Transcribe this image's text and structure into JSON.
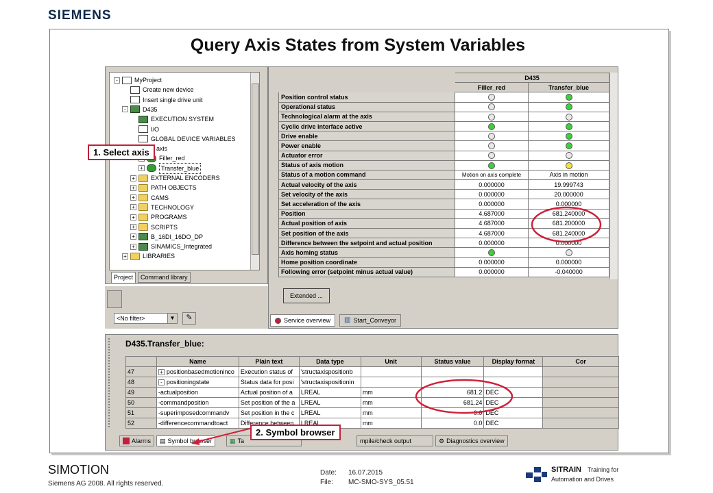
{
  "brand": "SIEMENS",
  "title": "Query Axis States from System Variables",
  "project_tree": {
    "items": [
      {
        "label": "MyProject",
        "level": 0,
        "icon": "project-icon",
        "expander": "-"
      },
      {
        "label": "Create new device",
        "level": 1,
        "icon": "new-device-icon",
        "expander": ""
      },
      {
        "label": "Insert single drive unit",
        "level": 1,
        "icon": "new-device-icon",
        "expander": ""
      },
      {
        "label": "D435",
        "level": 1,
        "icon": "device-icon",
        "expander": "-"
      },
      {
        "label": "EXECUTION SYSTEM",
        "level": 2,
        "icon": "execution-icon",
        "expander": ""
      },
      {
        "label": "I/O",
        "level": 2,
        "icon": "io-icon",
        "expander": ""
      },
      {
        "label": "GLOBAL DEVICE VARIABLES",
        "level": 2,
        "icon": "variables-icon",
        "expander": ""
      },
      {
        "label": "rt axis",
        "level": 2,
        "icon": "folder-icon",
        "expander": "-"
      },
      {
        "label": "Filler_red",
        "level": 3,
        "icon": "axis-icon",
        "expander": "+"
      },
      {
        "label": "Transfer_blue",
        "level": 3,
        "icon": "axis-icon",
        "expander": "+"
      },
      {
        "label": "EXTERNAL ENCODERS",
        "level": 2,
        "icon": "folder-icon",
        "expander": "+"
      },
      {
        "label": "PATH OBJECTS",
        "level": 2,
        "icon": "folder-icon",
        "expander": "+"
      },
      {
        "label": "CAMS",
        "level": 2,
        "icon": "folder-icon",
        "expander": "+"
      },
      {
        "label": "TECHNOLOGY",
        "level": 2,
        "icon": "folder-icon",
        "expander": "+"
      },
      {
        "label": "PROGRAMS",
        "level": 2,
        "icon": "folder-icon",
        "expander": "+"
      },
      {
        "label": "SCRIPTS",
        "level": 2,
        "icon": "folder-icon",
        "expander": "+"
      },
      {
        "label": "B_16DI_16DO_DP",
        "level": 2,
        "icon": "device-icon",
        "expander": "+"
      },
      {
        "label": "SINAMICS_Integrated",
        "level": 2,
        "icon": "device-icon",
        "expander": "+"
      },
      {
        "label": "LIBRARIES",
        "level": 1,
        "icon": "folder-icon",
        "expander": "+"
      }
    ],
    "tabs": [
      "Project",
      "Command library"
    ]
  },
  "filter": {
    "value": "<No filter>"
  },
  "service": {
    "device": "D435",
    "columns": [
      "Filler_red",
      "Transfer_blue"
    ],
    "rows": [
      {
        "label": "Position control status",
        "a": "off",
        "b": "on"
      },
      {
        "label": "Operational status",
        "a": "off",
        "b": "on"
      },
      {
        "label": "Technological alarm at the axis",
        "a": "off",
        "b": "off"
      },
      {
        "label": "Cyclic drive interface active",
        "a": "on",
        "b": "on"
      },
      {
        "label": "Drive enable",
        "a": "off",
        "b": "on"
      },
      {
        "label": "Power enable",
        "a": "off",
        "b": "on"
      },
      {
        "label": "Actuator error",
        "a": "off",
        "b": "off"
      },
      {
        "label": "Status of axis motion",
        "a": "on",
        "b": "yellow"
      },
      {
        "label": "Status of a motion command",
        "a": "Motion on axis complete",
        "b": "Axis in motion"
      },
      {
        "label": "Actual velocity of the axis",
        "a": "0.000000",
        "b": "19.999743"
      },
      {
        "label": "Set velocity of the axis",
        "a": "0.000000",
        "b": "20.000000"
      },
      {
        "label": "Set acceleration of the axis",
        "a": "0.000000",
        "b": "0.000000"
      },
      {
        "label": "Position",
        "a": "4.687000",
        "b": "681.240000"
      },
      {
        "label": "Actual position of axis",
        "a": "4.687000",
        "b": "681.200000"
      },
      {
        "label": "Set position of the axis",
        "a": "4.687000",
        "b": "681.240000"
      },
      {
        "label": "Difference between the setpoint and actual position",
        "a": "0.000000",
        "b": "0.000000"
      },
      {
        "label": "Axis homing status",
        "a": "on",
        "b": "off"
      },
      {
        "label": "Home position coordinate",
        "a": "0.000000",
        "b": "0.000000"
      },
      {
        "label": "Following error (setpoint minus actual value)",
        "a": "0.000000",
        "b": "-0.040000"
      }
    ],
    "extended_label": "Extended ...",
    "tabs": [
      "Service overview",
      "Start_Conveyor"
    ]
  },
  "symbol_browser": {
    "heading": "D435.Transfer_blue:",
    "headers": [
      "Name",
      "Plain text",
      "Data type",
      "Unit",
      "Status value",
      "Display format",
      "Cor"
    ],
    "rows": [
      {
        "no": "47",
        "exp": "+",
        "name": "positionbasedmotioninco",
        "plain": "Execution status of",
        "type": "'structaxispositionb",
        "unit": "",
        "value": "",
        "format": ""
      },
      {
        "no": "48",
        "exp": "-",
        "name": "positioningstate",
        "plain": "Status data for posi",
        "type": "'structaxispositionin",
        "unit": "",
        "value": "",
        "format": ""
      },
      {
        "no": "49",
        "exp": "",
        "name": "-actualposition",
        "plain": "Actual position of a",
        "type": "LREAL",
        "unit": "mm",
        "value": "681.2",
        "format": "DEC"
      },
      {
        "no": "50",
        "exp": "",
        "name": "-commandposition",
        "plain": "Set position of the a",
        "type": "LREAL",
        "unit": "mm",
        "value": "681.24",
        "format": "DEC"
      },
      {
        "no": "51",
        "exp": "",
        "name": "-superimposedcommandv",
        "plain": "Set position in the c",
        "type": "LREAL",
        "unit": "mm",
        "value": "0.0",
        "format": "DEC"
      },
      {
        "no": "52",
        "exp": "",
        "name": "-differencecommandtoact",
        "plain": "Difference between",
        "type": "LREAL",
        "unit": "mm",
        "value": "0.0",
        "format": "DEC"
      }
    ],
    "tabs": [
      "Alarms",
      "Symbol browser",
      "Ta",
      "mpile/check output",
      "Diagnostics overview"
    ]
  },
  "callouts": {
    "select_axis": "1. Select axis",
    "symbol_browser": "2. Symbol browser"
  },
  "footer": {
    "product": "SIMOTION",
    "copyright": "Siemens AG 2008. All rights reserved.",
    "date_label": "Date:",
    "date_value": "16.07.2015",
    "file_label": "File:",
    "file_value": "MC-SMO-SYS_05.51",
    "sitrain": "SITRAIN",
    "tagline1": "Training for",
    "tagline2": "Automation and Drives"
  },
  "colors": {
    "highlight": "#d0203a",
    "led_on": "#3ecf3e",
    "led_motion": "#f2e23a"
  }
}
